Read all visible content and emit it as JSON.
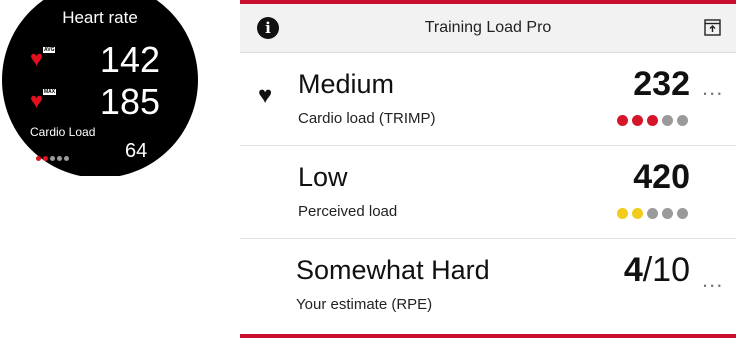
{
  "watch": {
    "title": "Heart rate",
    "avg_tag": "AVG",
    "max_tag": "MAX",
    "avg_value": "142",
    "max_value": "185",
    "cardio_label": "Cardio Load",
    "cardio_value": "64",
    "cardio_dots": {
      "total": 5,
      "filled": 2,
      "filled_color": "#e0101e",
      "empty_color": "#9a9a9a"
    },
    "heart_icon": "heart-icon"
  },
  "app": {
    "title": "Training Load Pro",
    "info_icon": "info-icon",
    "info_glyph": "i",
    "export_icon": "export-icon",
    "accent_color": "#c8102e",
    "rows": [
      {
        "title": "Medium",
        "subtitle": "Cardio load (TRIMP)",
        "value": "232",
        "more": "...",
        "dots": {
          "total": 5,
          "filled": 3,
          "filled_color": "#d5152a",
          "empty_color": "#9a9a9a"
        }
      },
      {
        "title": "Low",
        "subtitle": "Perceived load",
        "value": "420",
        "dots": {
          "total": 5,
          "filled": 2,
          "filled_color": "#f2cb1d",
          "empty_color": "#9a9a9a"
        }
      },
      {
        "title": "Somewhat Hard",
        "subtitle": "Your estimate (RPE)",
        "value": "4",
        "value_denominator": "/10",
        "more": "..."
      }
    ]
  }
}
